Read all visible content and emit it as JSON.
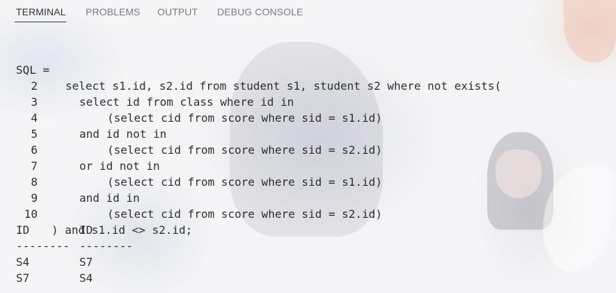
{
  "tabs": [
    {
      "label": "TERMINAL",
      "active": true
    },
    {
      "label": "PROBLEMS",
      "active": false
    },
    {
      "label": "OUTPUT",
      "active": false
    },
    {
      "label": "DEBUG CONSOLE",
      "active": false
    }
  ],
  "terminal": {
    "prompt": "SQL =",
    "lines": [
      {
        "num": "",
        "code": "select s1.id, s2.id from student s1, student s2 where not exists("
      },
      {
        "num": "2",
        "code": "select id from class where id in"
      },
      {
        "num": "3",
        "code": "(select cid from score where sid = s1.id)"
      },
      {
        "num": "4",
        "code": "and id not in"
      },
      {
        "num": "5",
        "code": "(select cid from score where sid = s2.id)"
      },
      {
        "num": "6",
        "code": "or id not in"
      },
      {
        "num": "7",
        "code": "(select cid from score where sid = s1.id)"
      },
      {
        "num": "8",
        "code": "and id in"
      },
      {
        "num": "9",
        "code": "(select cid from score where sid = s2.id)"
      },
      {
        "num": "10",
        "code": ") and s1.id <> s2.id;"
      }
    ],
    "result": {
      "headers": [
        "ID",
        "ID"
      ],
      "separators": [
        "--------",
        "--------"
      ],
      "rows": [
        [
          "S4",
          "S7"
        ],
        [
          "S7",
          "S4"
        ]
      ]
    }
  },
  "colors": {
    "active_tab": "#333333",
    "inactive_tab": "#7a7a86",
    "text": "#2e2e2e"
  }
}
